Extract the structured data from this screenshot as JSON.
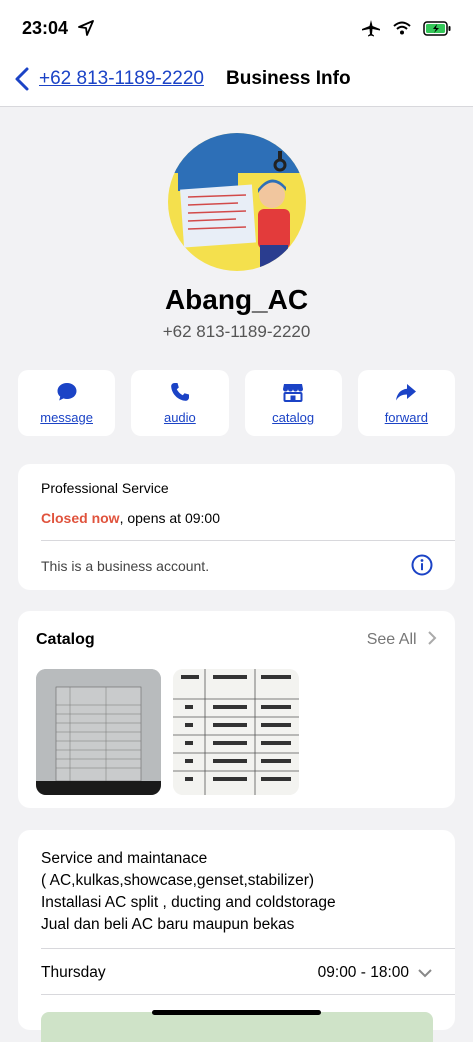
{
  "status": {
    "time": "23:04"
  },
  "nav": {
    "back_text": "+62 813-1189-2220",
    "title": "Business Info"
  },
  "profile": {
    "name": "Abang_AC",
    "phone": "+62 813-1189-2220"
  },
  "actions": [
    {
      "label": "message",
      "icon": "message-icon"
    },
    {
      "label": "audio",
      "icon": "phone-icon"
    },
    {
      "label": "catalog",
      "icon": "store-icon"
    },
    {
      "label": "forward",
      "icon": "forward-icon"
    }
  ],
  "info": {
    "category": "Professional Service",
    "closed_text": "Closed now",
    "opens_text": ", opens at 09:00",
    "business_note": "This is a business account."
  },
  "catalog": {
    "title": "Catalog",
    "see_all": "See All"
  },
  "description": {
    "lines": [
      "Service and maintanace",
      "( AC,kulkas,showcase,genset,stabilizer)",
      "Installasi AC split , ducting and coldstorage",
      "Jual dan beli AC baru maupun bekas"
    ]
  },
  "schedule": {
    "day": "Thursday",
    "hours": "09:00 - 18:00"
  },
  "colors": {
    "link": "#1b43c6",
    "closed": "#e0533d",
    "bg": "#f2f2f4"
  }
}
